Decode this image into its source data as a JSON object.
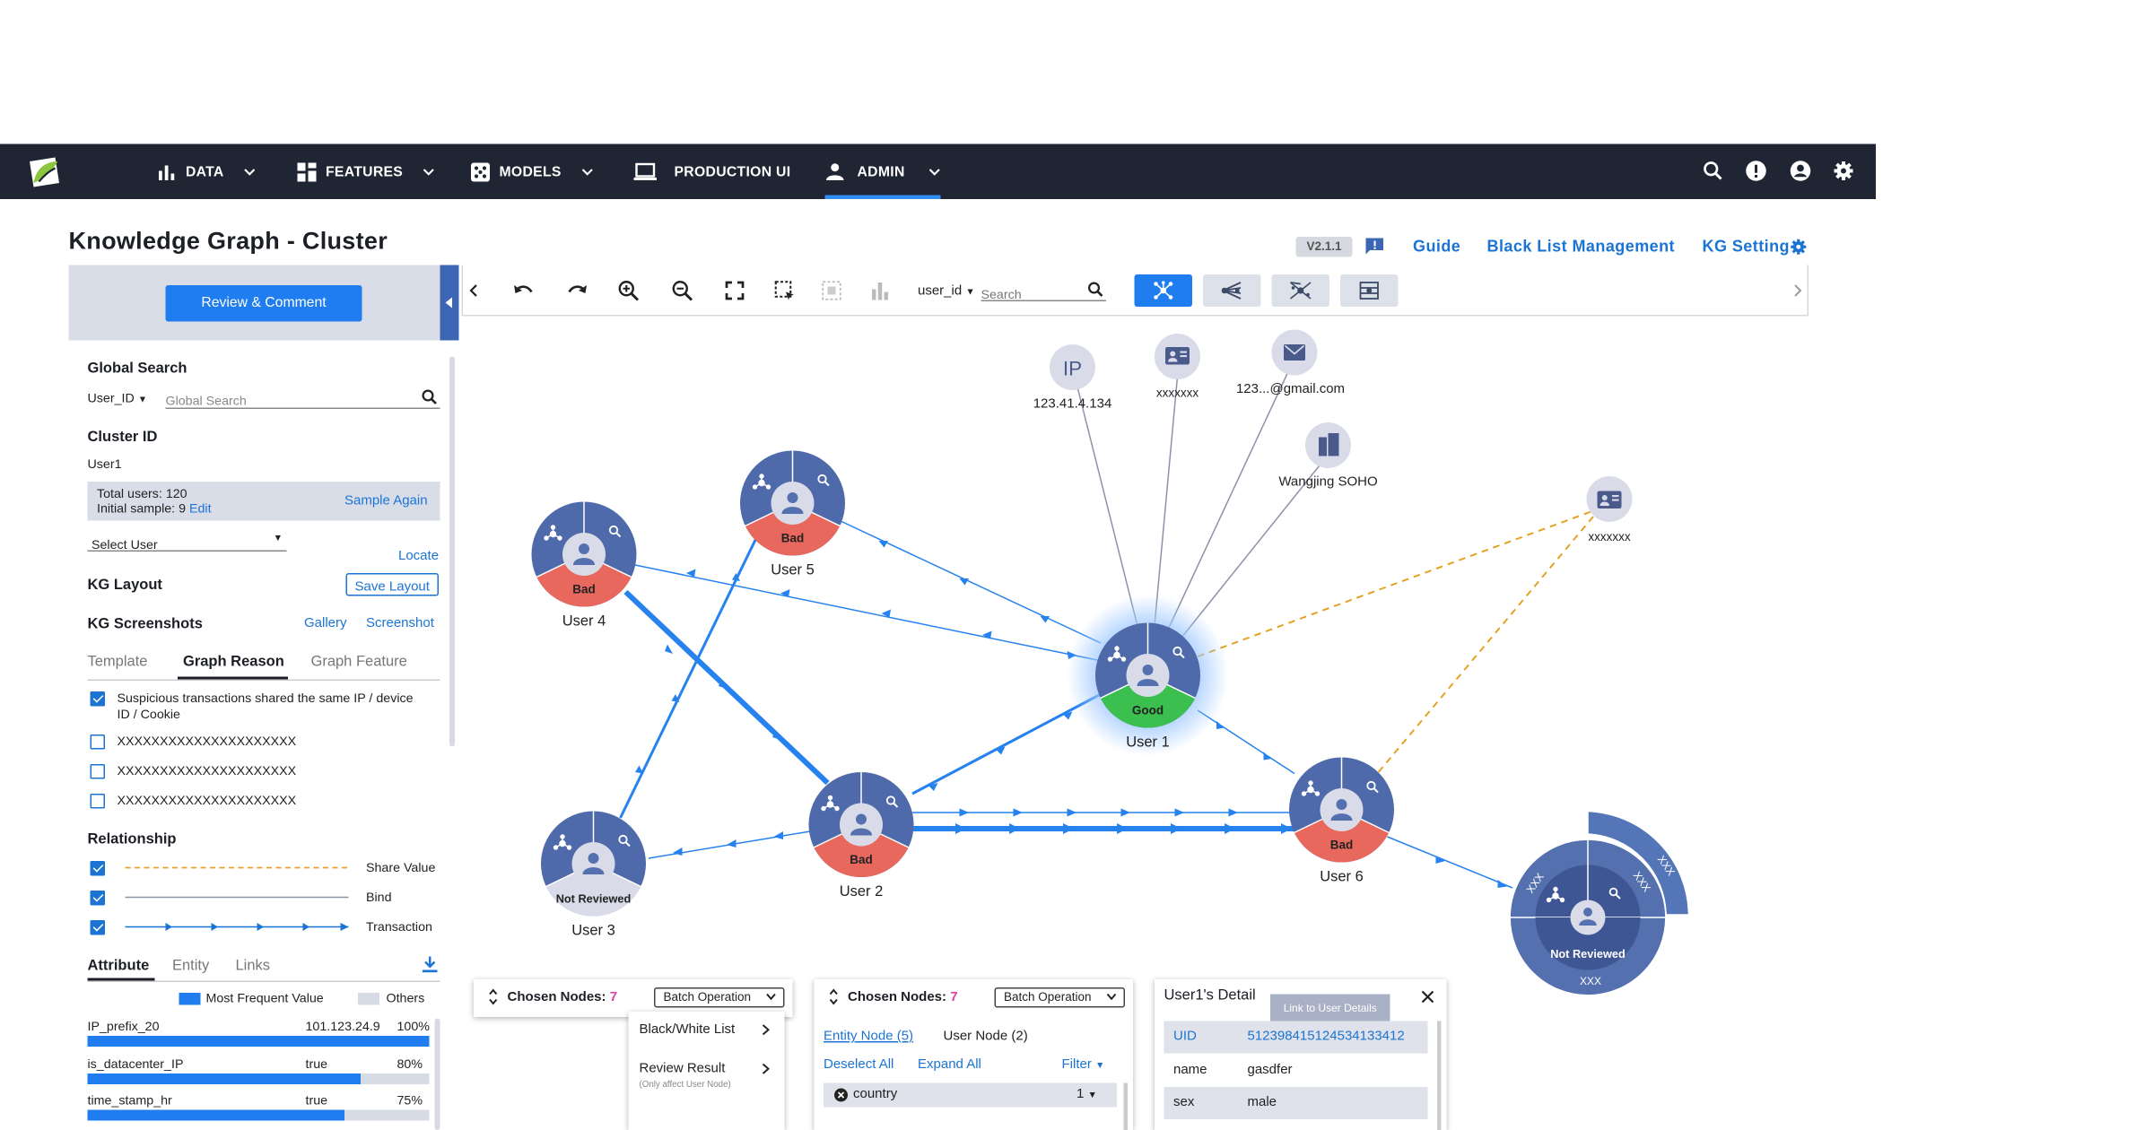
{
  "nav": {
    "items": [
      {
        "label": "DATA"
      },
      {
        "label": "FEATURES"
      },
      {
        "label": "MODELS"
      },
      {
        "label": "PRODUCTION UI"
      },
      {
        "label": "ADMIN"
      }
    ],
    "icons": [
      "search-icon",
      "alert-icon",
      "account-icon",
      "settings-icon"
    ]
  },
  "page": {
    "title": "Knowledge Graph - Cluster",
    "version": "V2.1.1",
    "links": {
      "guide": "Guide",
      "blacklist": "Black List Management",
      "kg_setting": "KG Setting"
    }
  },
  "left": {
    "review_button": "Review & Comment",
    "global_search": {
      "title": "Global Search",
      "type": "User_ID",
      "placeholder": "Global Search"
    },
    "cluster": {
      "title": "Cluster ID",
      "value": "User1",
      "total": "Total users: 120",
      "initial": "Initial sample: 9",
      "edit": "Edit",
      "sample_again": "Sample Again"
    },
    "select_user": "Select User",
    "locate": "Locate",
    "kg_layout": {
      "title": "KG Layout",
      "save": "Save Layout"
    },
    "kg_screenshots": {
      "title": "KG Screenshots",
      "gallery": "Gallery",
      "screenshot": "Screenshot"
    },
    "tabs": {
      "template": "Template",
      "graph_reason": "Graph Reason",
      "graph_feature": "Graph Feature"
    },
    "reasons": [
      {
        "line1": "Suspicious transactions shared the same IP / device",
        "line2": "ID / Cookie",
        "checked": true
      },
      {
        "line1": "XXXXXXXXXXXXXXXXXXXXX",
        "checked": false
      },
      {
        "line1": "XXXXXXXXXXXXXXXXXXXXX",
        "checked": false
      },
      {
        "line1": "XXXXXXXXXXXXXXXXXXXXX",
        "checked": false
      }
    ],
    "relationship": {
      "title": "Relationship",
      "items": [
        {
          "label": "Share Value"
        },
        {
          "label": "Bind"
        },
        {
          "label": "Transaction"
        }
      ]
    },
    "attr_tabs": {
      "attribute": "Attribute",
      "entity": "Entity",
      "links": "Links"
    },
    "legend": {
      "frequent": "Most Frequent Value",
      "others": "Others"
    },
    "attributes": [
      {
        "name": "IP_prefix_20",
        "value": "101.123.24.9",
        "pct": "100%",
        "fraction": 1.0
      },
      {
        "name": "is_datacenter_IP",
        "value": "true",
        "pct": "80%",
        "fraction": 0.8
      },
      {
        "name": "time_stamp_hr",
        "value": "true",
        "pct": "75%",
        "fraction": 0.75
      }
    ]
  },
  "toolbar": {
    "search_type": "user_id",
    "search_placeholder": "Search"
  },
  "graph": {
    "users": [
      {
        "name": "User 1",
        "status": "Good"
      },
      {
        "name": "User 2",
        "status": "Bad"
      },
      {
        "name": "User 3",
        "status": "Not Reviewed"
      },
      {
        "name": "User 4",
        "status": "Bad"
      },
      {
        "name": "User 5",
        "status": "Bad"
      },
      {
        "name": "User 6",
        "status": "Bad"
      }
    ],
    "big_node": {
      "status": "Not Reviewed",
      "labels": [
        "XXX",
        "XXX",
        "XXX",
        "XXX"
      ]
    },
    "entities": [
      {
        "icon": "IP",
        "label": "123.41.4.134"
      },
      {
        "icon": "id-card",
        "label": "xxxxxxx"
      },
      {
        "icon": "email",
        "label": "123...@gmail.com"
      },
      {
        "icon": "building",
        "label": "Wangjing SOHO"
      },
      {
        "icon": "id-card",
        "label": "xxxxxxx"
      }
    ]
  },
  "chosen1": {
    "title": "Chosen Nodes:",
    "count": "7",
    "batch": "Batch Operation",
    "menu": [
      "Black/White List",
      "Review Result",
      "(Only affect User Node)"
    ]
  },
  "chosen2": {
    "title": "Chosen Nodes:",
    "count": "7",
    "batch": "Batch Operation",
    "tab_entity": "Entity Node (5)",
    "tab_user": "User Node (2)",
    "deselect": "Deselect All",
    "expand": "Expand All",
    "filter": "Filter",
    "row_label": "country",
    "row_count": "1"
  },
  "detail": {
    "title": "User1's Detail",
    "tooltip": "Link to User Details",
    "rows": [
      {
        "k": "UID",
        "v": "5123984151245341334​12"
      },
      {
        "k": "name",
        "v": "gasdfer"
      },
      {
        "k": "sex",
        "v": "male"
      }
    ]
  }
}
